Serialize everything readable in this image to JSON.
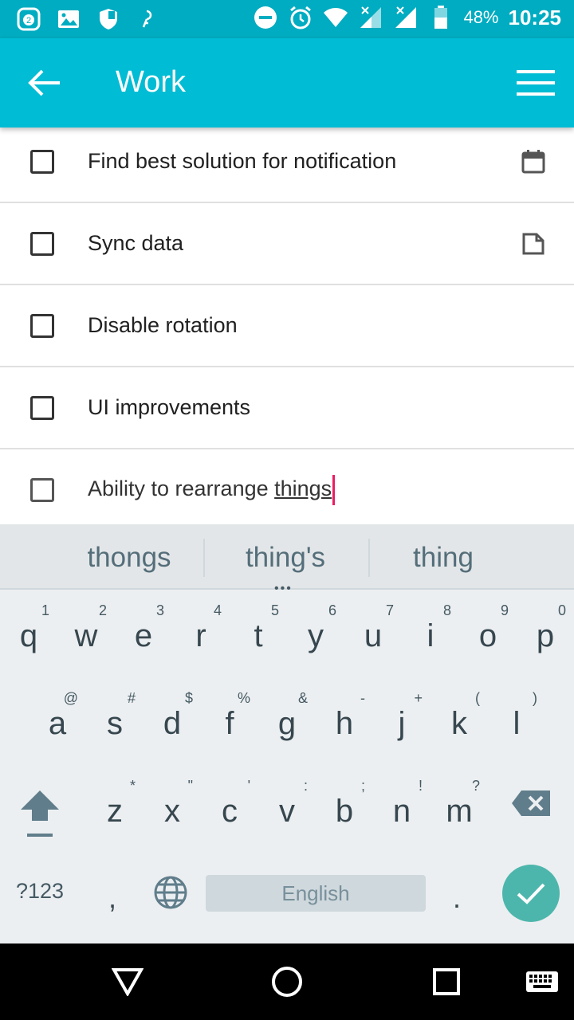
{
  "statusbar": {
    "battery": "48%",
    "time": "10:25",
    "notif_count": "2"
  },
  "appbar": {
    "title": "Work"
  },
  "tasks": [
    {
      "text": "Find best solution for notification",
      "icon": "calendar-icon"
    },
    {
      "text": "Sync data",
      "icon": "note-icon"
    },
    {
      "text": "Disable rotation",
      "icon": ""
    },
    {
      "text": "UI improvements",
      "icon": ""
    },
    {
      "text_prefix": "Ability to rearrange ",
      "text_word": "things",
      "icon": ""
    }
  ],
  "keyboard": {
    "suggestions": [
      "thongs",
      "thing's",
      "thing"
    ],
    "more_label": "•••",
    "row1": [
      [
        "q",
        "1"
      ],
      [
        "w",
        "2"
      ],
      [
        "e",
        "3"
      ],
      [
        "r",
        "4"
      ],
      [
        "t",
        "5"
      ],
      [
        "y",
        "6"
      ],
      [
        "u",
        "7"
      ],
      [
        "i",
        "8"
      ],
      [
        "o",
        "9"
      ],
      [
        "p",
        "0"
      ]
    ],
    "row2": [
      [
        "a",
        "@"
      ],
      [
        "s",
        "#"
      ],
      [
        "d",
        "$"
      ],
      [
        "f",
        "%"
      ],
      [
        "g",
        "&"
      ],
      [
        "h",
        "-"
      ],
      [
        "j",
        "+"
      ],
      [
        "k",
        "("
      ],
      [
        "l",
        ")"
      ]
    ],
    "row3": [
      [
        "z",
        "*"
      ],
      [
        "x",
        "\""
      ],
      [
        "c",
        "'"
      ],
      [
        "v",
        ":"
      ],
      [
        "b",
        ";"
      ],
      [
        "n",
        "!"
      ],
      [
        "m",
        "?"
      ]
    ],
    "symbols_label": "?123",
    "comma_label": ",",
    "space_label": "English",
    "period_label": "."
  },
  "colors": {
    "statusbar": "#00acc1",
    "appbar": "#00bcd4",
    "cursor": "#e91e63",
    "enter_button": "#4db6ac"
  }
}
